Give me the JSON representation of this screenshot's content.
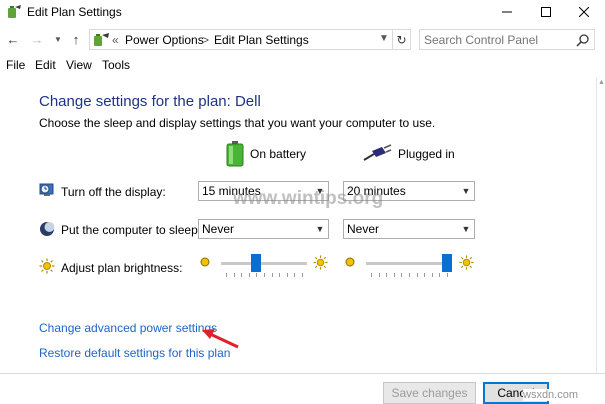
{
  "window": {
    "title": "Edit Plan Settings",
    "controls": {
      "minimize": "minimize",
      "maximize": "maximize",
      "close": "close"
    }
  },
  "address_bar": {
    "prefix": "«",
    "breadcrumbs": [
      "Power Options",
      "Edit Plan Settings"
    ],
    "separator": ">",
    "search_placeholder": "Search Control Panel"
  },
  "menu": {
    "items": [
      "File",
      "Edit",
      "View",
      "Tools"
    ]
  },
  "main": {
    "heading": "Change settings for the plan: Dell",
    "description": "Choose the sleep and display settings that you want your computer to use.",
    "columns": {
      "battery": "On battery",
      "plugged": "Plugged in"
    },
    "rows": [
      {
        "label": "Turn off the display:",
        "battery_value": "15 minutes",
        "plugged_value": "20 minutes",
        "icon": "monitor-clock-icon"
      },
      {
        "label": "Put the computer to sleep:",
        "battery_value": "Never",
        "plugged_value": "Never",
        "icon": "moon-icon"
      }
    ],
    "brightness": {
      "label": "Adjust plan brightness:",
      "battery_level": 0.4,
      "plugged_level": 1.0
    },
    "links": {
      "advanced": "Change advanced power settings",
      "restore": "Restore default settings for this plan"
    }
  },
  "footer": {
    "save": "Save changes",
    "cancel": "Cancel"
  },
  "watermarks": {
    "center": "www.wintips.org",
    "corner": "wsxdn.com"
  },
  "colors": {
    "heading": "#1e3287",
    "link": "#1e64c8",
    "slider_thumb": "#0a6fd1",
    "annotation_arrow": "#e0202a"
  }
}
